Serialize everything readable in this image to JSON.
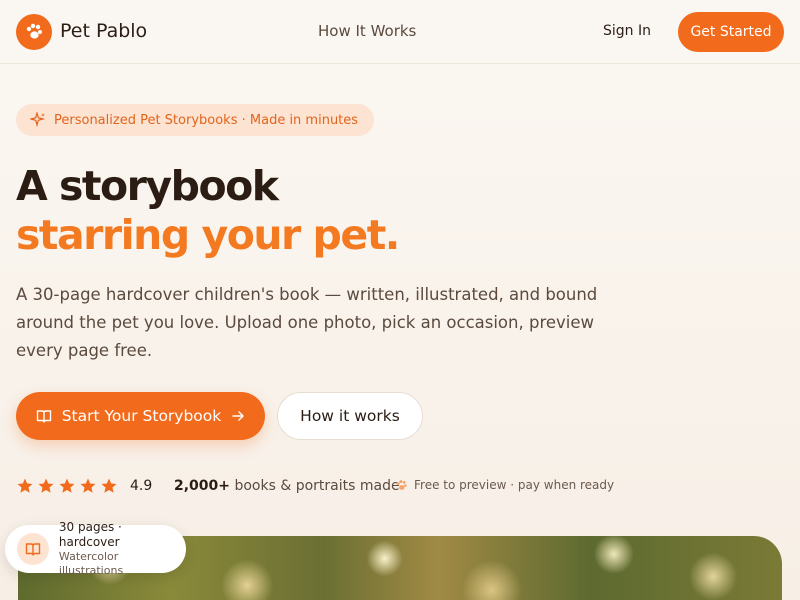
{
  "colors": {
    "accent": "#f26a1b",
    "accent_light": "#fde3d2",
    "text_dark": "#2b1d14"
  },
  "header": {
    "brand": "Pet Pablo",
    "logo_icon": "paw-icon",
    "nav_link": "How It Works",
    "sign_in": "Sign In",
    "get_started": "Get Started"
  },
  "hero": {
    "pill_icon": "sparkle-icon",
    "pill_text": "Personalized Pet Storybooks · Made in minutes",
    "title_line1": "A storybook",
    "title_line2": "starring your pet.",
    "description": "A 30-page hardcover children's book — written, illustrated, and bound around the pet you love. Upload one photo, pick an occasion, preview every page free.",
    "primary_button": "Start Your Storybook",
    "primary_icon": "book-icon",
    "primary_arrow": "arrow-right-icon",
    "secondary_button": "How it works"
  },
  "stats": {
    "stars": 5,
    "rating": "4.9",
    "books_count": "2,000+",
    "books_label": "books & portraits made",
    "free_icon": "paw-icon",
    "free_text": "Free to preview · pay when ready"
  },
  "badge": {
    "icon": "book-icon",
    "line1": "30 pages · hardcover",
    "line2": "Watercolor illustrations"
  }
}
